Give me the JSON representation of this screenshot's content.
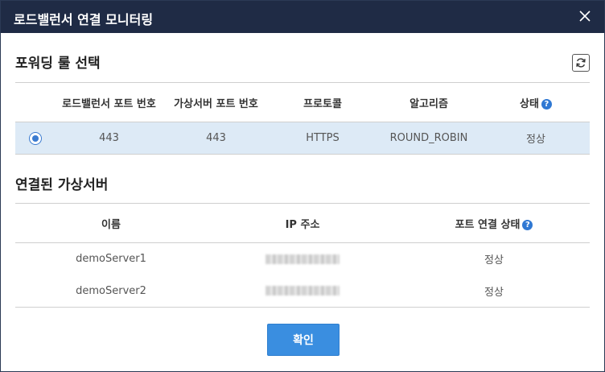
{
  "dialog": {
    "title": "로드밸런서 연결 모니터링"
  },
  "forwarding": {
    "section_title": "포워딩 룰 선택",
    "columns": [
      "",
      "로드밸런서 포트 번호",
      "가상서버 포트 번호",
      "프로토콜",
      "알고리즘",
      "상태"
    ],
    "rows": [
      {
        "selected": true,
        "lb_port": "443",
        "vm_port": "443",
        "protocol": "HTTPS",
        "algorithm": "ROUND_ROBIN",
        "status": "정상"
      }
    ]
  },
  "servers": {
    "section_title": "연결된 가상서버",
    "columns": [
      "이름",
      "IP 주소",
      "포트 연결 상태"
    ],
    "rows": [
      {
        "name": "demoServer1",
        "status": "정상"
      },
      {
        "name": "demoServer2",
        "status": "정상"
      }
    ]
  },
  "buttons": {
    "confirm": "확인"
  },
  "icons": {
    "close": "close-icon",
    "refresh": "refresh-icon",
    "help": "question-circle-icon",
    "radio": "radio-selected-icon"
  },
  "colors": {
    "titlebar": "#1f2b45",
    "selected_row": "#ddeaf6",
    "accent": "#3a8ee0",
    "help_icon": "#2f78d3"
  }
}
